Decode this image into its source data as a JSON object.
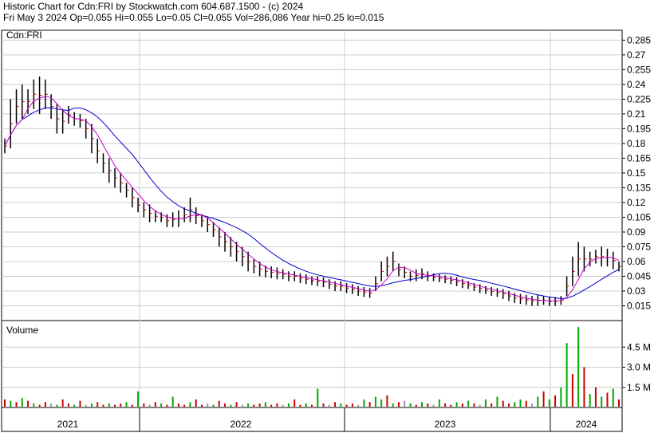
{
  "header": {
    "line1": "Historic Chart for Cdn:FRI by Stockwatch.com 604.687.1500 - (c) 2024",
    "line2": "Fri May  3 2024   Op=0.055   Hi=0.055   Lo=0.05   Cl=0.055   Vol=286,086   Year hi=0.25   lo=0.015"
  },
  "price_panel": {
    "label": "Cdn:FRI"
  },
  "volume_panel": {
    "label": "Volume"
  },
  "chart_data": [
    {
      "type": "candlestick",
      "title": "Cdn:FRI",
      "y_ticks": [
        "0.285",
        "0.27",
        "0.255",
        "0.24",
        "0.225",
        "0.21",
        "0.195",
        "0.18",
        "0.165",
        "0.15",
        "0.135",
        "0.12",
        "0.105",
        "0.09",
        "0.075",
        "0.06",
        "0.045",
        "0.03",
        "0.015"
      ],
      "ylim": [
        0.0,
        0.295
      ],
      "x_ticks": [
        "2021",
        "2022",
        "2023",
        "2024"
      ],
      "grid": true,
      "colors": {
        "bars": "#000000",
        "ma_short": "#cc00cc",
        "ma_long": "#0000cc",
        "close_marks": "#cc0000",
        "grid": "#cccccc"
      },
      "series": [
        {
          "values": [
            [
              0.185,
              0.17
            ],
            [
              0.225,
              0.175
            ],
            [
              0.235,
              0.2
            ],
            [
              0.24,
              0.205
            ],
            [
              0.235,
              0.21
            ],
            [
              0.245,
              0.215
            ],
            [
              0.248,
              0.21
            ],
            [
              0.245,
              0.215
            ],
            [
              0.23,
              0.205
            ],
            [
              0.22,
              0.19
            ],
            [
              0.215,
              0.19
            ],
            [
              0.218,
              0.2
            ],
            [
              0.212,
              0.198
            ],
            [
              0.21,
              0.196
            ],
            [
              0.205,
              0.185
            ],
            [
              0.2,
              0.17
            ],
            [
              0.185,
              0.16
            ],
            [
              0.17,
              0.15
            ],
            [
              0.165,
              0.14
            ],
            [
              0.155,
              0.135
            ],
            [
              0.15,
              0.13
            ],
            [
              0.14,
              0.125
            ],
            [
              0.135,
              0.115
            ],
            [
              0.125,
              0.11
            ],
            [
              0.12,
              0.105
            ],
            [
              0.118,
              0.1
            ],
            [
              0.112,
              0.1
            ],
            [
              0.11,
              0.1
            ],
            [
              0.108,
              0.095
            ],
            [
              0.11,
              0.095
            ],
            [
              0.112,
              0.095
            ],
            [
              0.115,
              0.1
            ],
            [
              0.125,
              0.1
            ],
            [
              0.115,
              0.098
            ],
            [
              0.108,
              0.095
            ],
            [
              0.105,
              0.09
            ],
            [
              0.1,
              0.085
            ],
            [
              0.095,
              0.075
            ],
            [
              0.09,
              0.07
            ],
            [
              0.085,
              0.065
            ],
            [
              0.08,
              0.06
            ],
            [
              0.075,
              0.055
            ],
            [
              0.07,
              0.05
            ],
            [
              0.062,
              0.048
            ],
            [
              0.06,
              0.045
            ],
            [
              0.056,
              0.044
            ],
            [
              0.055,
              0.043
            ],
            [
              0.054,
              0.042
            ],
            [
              0.052,
              0.042
            ],
            [
              0.05,
              0.04
            ],
            [
              0.05,
              0.04
            ],
            [
              0.048,
              0.038
            ],
            [
              0.047,
              0.037
            ],
            [
              0.045,
              0.036
            ],
            [
              0.045,
              0.035
            ],
            [
              0.044,
              0.034
            ],
            [
              0.042,
              0.032
            ],
            [
              0.04,
              0.03
            ],
            [
              0.04,
              0.03
            ],
            [
              0.038,
              0.028
            ],
            [
              0.037,
              0.027
            ],
            [
              0.035,
              0.025
            ],
            [
              0.034,
              0.024
            ],
            [
              0.033,
              0.023
            ],
            [
              0.045,
              0.03
            ],
            [
              0.06,
              0.04
            ],
            [
              0.065,
              0.045
            ],
            [
              0.07,
              0.05
            ],
            [
              0.058,
              0.045
            ],
            [
              0.055,
              0.043
            ],
            [
              0.05,
              0.04
            ],
            [
              0.052,
              0.04
            ],
            [
              0.053,
              0.042
            ],
            [
              0.05,
              0.04
            ],
            [
              0.048,
              0.04
            ],
            [
              0.047,
              0.039
            ],
            [
              0.046,
              0.038
            ],
            [
              0.045,
              0.037
            ],
            [
              0.044,
              0.035
            ],
            [
              0.042,
              0.033
            ],
            [
              0.04,
              0.032
            ],
            [
              0.038,
              0.03
            ],
            [
              0.037,
              0.028
            ],
            [
              0.035,
              0.027
            ],
            [
              0.034,
              0.025
            ],
            [
              0.033,
              0.024
            ],
            [
              0.032,
              0.022
            ],
            [
              0.03,
              0.02
            ],
            [
              0.028,
              0.018
            ],
            [
              0.027,
              0.017
            ],
            [
              0.026,
              0.016
            ],
            [
              0.025,
              0.015
            ],
            [
              0.026,
              0.015
            ],
            [
              0.025,
              0.016
            ],
            [
              0.024,
              0.015
            ],
            [
              0.024,
              0.015
            ],
            [
              0.025,
              0.016
            ],
            [
              0.045,
              0.025
            ],
            [
              0.065,
              0.035
            ],
            [
              0.08,
              0.045
            ],
            [
              0.075,
              0.05
            ],
            [
              0.07,
              0.055
            ],
            [
              0.072,
              0.058
            ],
            [
              0.075,
              0.055
            ],
            [
              0.073,
              0.055
            ],
            [
              0.07,
              0.052
            ],
            [
              0.06,
              0.05
            ]
          ]
        }
      ]
    },
    {
      "type": "bar",
      "title": "Volume",
      "y_ticks": [
        "4.5 M",
        "3.0 M",
        "1.5 M"
      ],
      "ylim": [
        0,
        6
      ],
      "x_ticks": [
        "2021",
        "2022",
        "2023",
        "2024"
      ],
      "colors": {
        "up": "#00aa00",
        "down": "#cc0000",
        "flat": "#999999"
      },
      "values": [
        0.6,
        0.5,
        0.4,
        0.7,
        0.5,
        0.3,
        0.2,
        0.4,
        0.3,
        0.2,
        0.6,
        0.3,
        0.2,
        0.5,
        0.2,
        0.3,
        0.4,
        0.2,
        0.3,
        0.2,
        0.3,
        0.4,
        0.2,
        1.2,
        0.3,
        0.2,
        0.4,
        0.3,
        0.2,
        0.8,
        0.3,
        0.2,
        0.4,
        0.6,
        0.2,
        0.3,
        0.2,
        0.5,
        0.3,
        0.2,
        0.4,
        0.2,
        0.3,
        0.2,
        0.3,
        0.4,
        0.2,
        0.3,
        0.2,
        0.3,
        0.6,
        0.2,
        0.3,
        0.2,
        1.4,
        0.3,
        0.2,
        0.4,
        0.3,
        0.2,
        0.3,
        0.2,
        0.6,
        0.4,
        0.8,
        0.6,
        0.9,
        0.3,
        0.4,
        0.5,
        0.3,
        0.2,
        0.4,
        0.3,
        0.2,
        0.6,
        0.3,
        0.2,
        0.4,
        0.3,
        0.5,
        0.3,
        0.2,
        0.6,
        0.3,
        0.8,
        0.5,
        0.3,
        0.4,
        0.6,
        0.5,
        0.3,
        0.8,
        1.2,
        0.6,
        0.9,
        1.5,
        4.8,
        2.5,
        6.0,
        3.0,
        1.0,
        1.5,
        0.8,
        1.1,
        1.4,
        0.6
      ],
      "directions": [
        "down",
        "up",
        "down",
        "up",
        "down",
        "up",
        "down",
        "down",
        "flat",
        "up",
        "down",
        "down",
        "up",
        "down",
        "flat",
        "up",
        "down",
        "down",
        "up",
        "down",
        "down",
        "up",
        "down",
        "up",
        "down",
        "flat",
        "down",
        "up",
        "down",
        "up",
        "down",
        "down",
        "up",
        "down",
        "down",
        "flat",
        "up",
        "down",
        "down",
        "up",
        "down",
        "flat",
        "up",
        "down",
        "down",
        "up",
        "down",
        "down",
        "flat",
        "up",
        "down",
        "down",
        "up",
        "down",
        "up",
        "down",
        "flat",
        "down",
        "up",
        "down",
        "down",
        "flat",
        "up",
        "down",
        "up",
        "up",
        "down",
        "up",
        "down",
        "flat",
        "up",
        "down",
        "up",
        "down",
        "flat",
        "up",
        "down",
        "down",
        "up",
        "down",
        "up",
        "down",
        "flat",
        "up",
        "down",
        "up",
        "down",
        "down",
        "up",
        "up",
        "down",
        "flat",
        "up",
        "down",
        "up",
        "down",
        "up",
        "up",
        "down",
        "up",
        "down",
        "up",
        "down",
        "up",
        "down",
        "up",
        "down"
      ]
    }
  ]
}
